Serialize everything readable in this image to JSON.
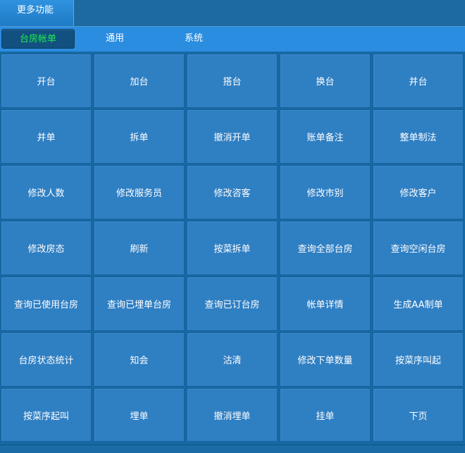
{
  "title_tab": "更多功能",
  "tabs": [
    {
      "label": "台房帐单",
      "active": true
    },
    {
      "label": "通用",
      "active": false
    },
    {
      "label": "系统",
      "active": false
    }
  ],
  "buttons": [
    "开台",
    "加台",
    "搭台",
    "换台",
    "并台",
    "并单",
    "拆单",
    "撤消开单",
    "账单备注",
    "整单制法",
    "修改人数",
    "修改服务员",
    "修改咨客",
    "修改市别",
    "修改客户",
    "修改房态",
    "刷新",
    "按菜拆单",
    "查询全部台房",
    "查询空闲台房",
    "查询已使用台房",
    "查询已埋单台房",
    "查询已订台房",
    "帐单详情",
    "生成AA制单",
    "台房状态统计",
    "知会",
    "沽清",
    "修改下单数量",
    "按菜序叫起",
    "按菜序起叫",
    "埋单",
    "撤消埋单",
    "挂单",
    "下页"
  ],
  "colors": {
    "background": "#166aa4",
    "tab_strip": "#2b8de0",
    "active_tab_bg": "#12507f",
    "active_tab_text": "#19f04a",
    "button_bg": "#2f7fc3"
  }
}
